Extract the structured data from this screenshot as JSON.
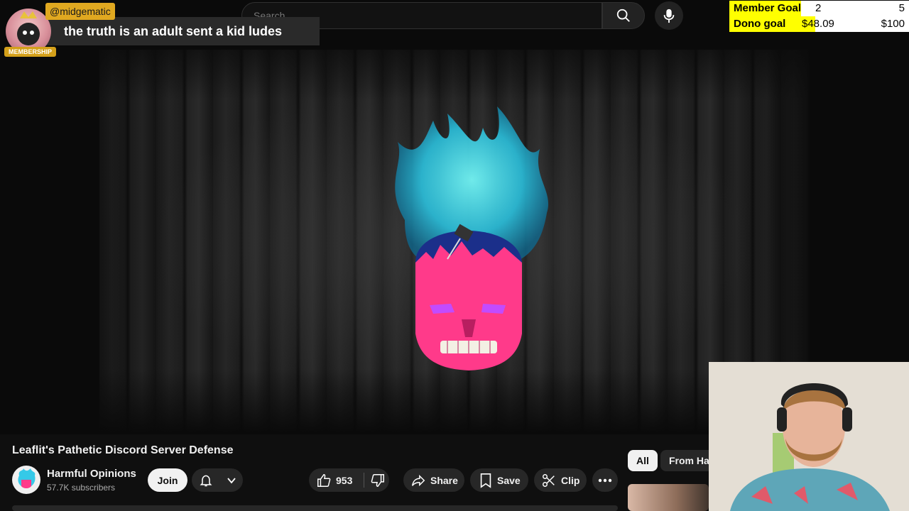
{
  "search": {
    "placeholder": "Search"
  },
  "chat_overlay": {
    "username": "@midgematic",
    "message": "the truth is an adult sent a kid ludes",
    "badge": "MEMBERSHIP"
  },
  "goals": [
    {
      "label": "Member Goal",
      "current": "2",
      "target": "5",
      "progress": 0.4,
      "color": "#ffff00"
    },
    {
      "label": "Dono goal",
      "current": "$48.09",
      "target": "$100",
      "progress": 0.48,
      "color": "#ffff00"
    }
  ],
  "video": {
    "title": "Leaflit's Pathetic Discord Server Defense",
    "channel_name": "Harmful Opinions",
    "subscribers": "57.7K subscribers",
    "join_label": "Join",
    "like_count": "953",
    "share_label": "Share",
    "save_label": "Save",
    "clip_label": "Clip"
  },
  "chips": [
    {
      "label": "All"
    },
    {
      "label": "From Harmful Opinions"
    }
  ],
  "icons": [
    "search-icon",
    "mic-icon",
    "bell-icon",
    "chevron-down-icon",
    "like-icon",
    "dislike-icon",
    "share-icon",
    "save-icon",
    "clip-icon",
    "more-icon"
  ],
  "colors": {
    "background": "#0f0f0f",
    "accent_pill": "#272727",
    "goal_fill": "#ffff00"
  }
}
